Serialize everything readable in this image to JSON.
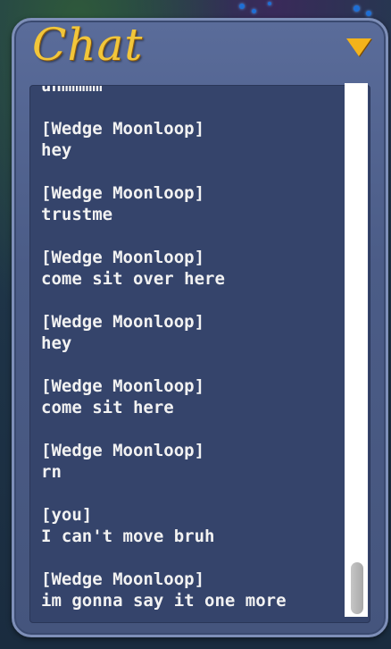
{
  "chat": {
    "title": "Chat",
    "menu_icon": "dropdown-arrow-icon",
    "accent_color": "#f2c63a",
    "scroll_position": 0.98,
    "messages": [
      {
        "speaker": "",
        "text": "uhmmmm"
      },
      {
        "speaker": "[Wedge Moonloop]",
        "text": "hey"
      },
      {
        "speaker": "[Wedge Moonloop]",
        "text": "trustme"
      },
      {
        "speaker": "[Wedge Moonloop]",
        "text": "come sit over here"
      },
      {
        "speaker": "[Wedge Moonloop]",
        "text": "hey"
      },
      {
        "speaker": "[Wedge Moonloop]",
        "text": "come sit here"
      },
      {
        "speaker": "[Wedge Moonloop]",
        "text": "rn"
      },
      {
        "speaker": "[you]",
        "text": "I can't move bruh"
      },
      {
        "speaker": "[Wedge Moonloop]",
        "text": "im gonna say it one more"
      }
    ]
  }
}
